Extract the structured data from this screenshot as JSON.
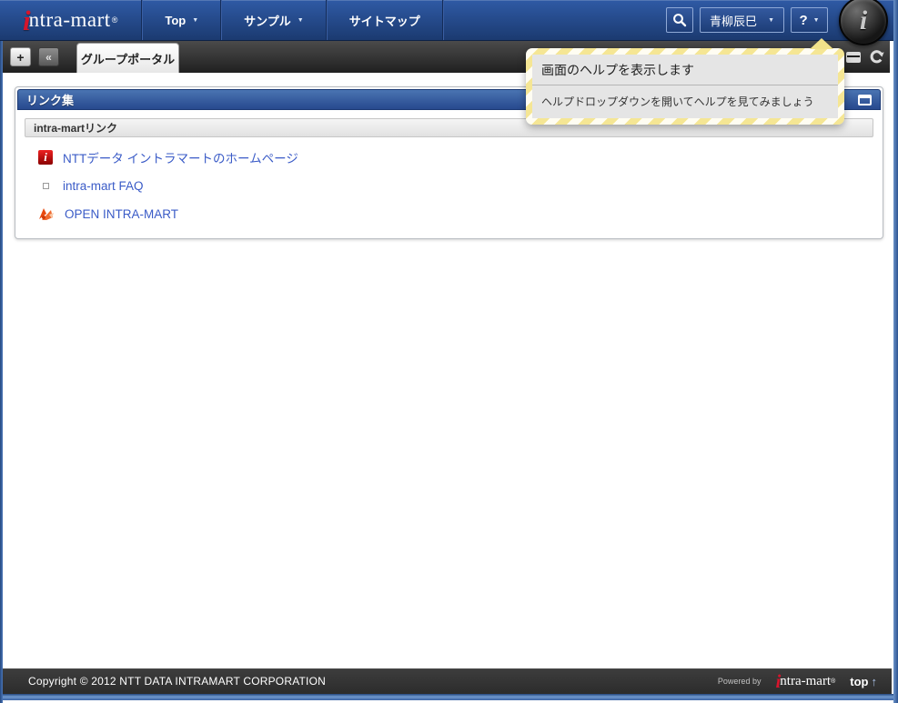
{
  "navbar": {
    "logo": {
      "i": "i",
      "rest": "ntra-mart",
      "reg": "®"
    },
    "menus": [
      {
        "label": "Top",
        "has_caret": true
      },
      {
        "label": "サンプル",
        "has_caret": true
      },
      {
        "label": "サイトマップ",
        "has_caret": false
      }
    ],
    "user": {
      "name": "青柳辰巳"
    },
    "help": {
      "label": "?"
    }
  },
  "tabbar": {
    "add_label": "+",
    "collapse_label": "«",
    "tabs": [
      {
        "label": "グループポータル",
        "active": true
      }
    ]
  },
  "tooltip": {
    "title": "画面のヘルプを表示します",
    "body": "ヘルプドロップダウンを開いてヘルプを見てみましょう"
  },
  "panel": {
    "title": "リンク集",
    "section": "intra-martリンク",
    "links": [
      {
        "icon": "intra-mart-favicon",
        "label": "NTTデータ イントラマートのホームページ"
      },
      {
        "icon": "square-bullet",
        "label": "intra-mart FAQ"
      },
      {
        "icon": "open-intra-mart-mascot",
        "label": "OPEN INTRA-MART"
      }
    ]
  },
  "footer": {
    "copyright": "Copyright © 2012 NTT DATA INTRAMART CORPORATION",
    "powered_by": "Powered by",
    "logo": {
      "i": "i",
      "rest": "ntra-mart",
      "reg": "®"
    },
    "top_label": "top"
  },
  "icons": {
    "caret_down": "▼",
    "up_arrow": "↑"
  },
  "colors": {
    "navbar_blue": "#1f3f7a",
    "panel_header_blue": "#27498e",
    "link_blue": "#3a5bc7",
    "stripe_yellow": "#f5e694",
    "footer_dark": "#333333",
    "brand_red": "#d6152c"
  }
}
